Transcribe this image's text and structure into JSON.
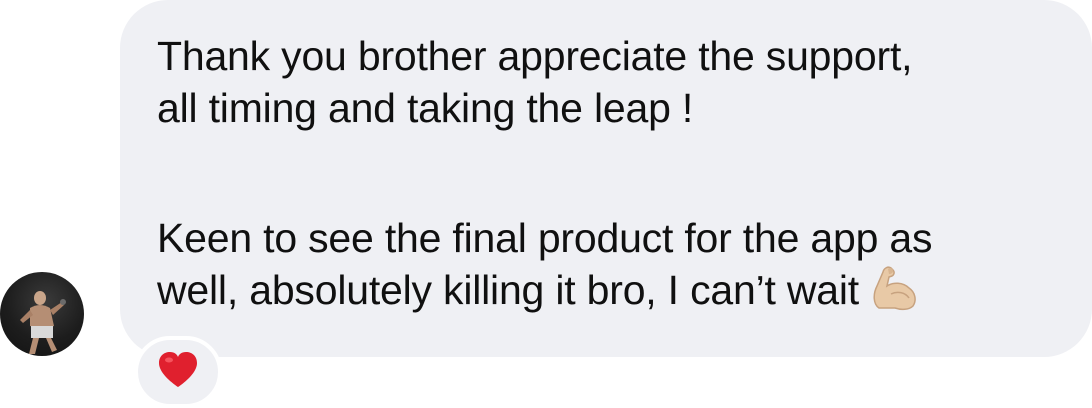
{
  "message": {
    "paragraph1_line1": "Thank you brother appreciate the support,",
    "paragraph1_line2": "all timing and taking the leap !",
    "paragraph2_line1": "Keen to see the final product for the app as",
    "paragraph2_line2": "well, absolutely killing it bro, I can’t wait",
    "trailing_emoji": "flexed-biceps-icon"
  },
  "reaction": {
    "icon": "heart-icon",
    "color": "#e0202e"
  },
  "colors": {
    "bubble_background": "#eff0f4",
    "text": "#101010"
  }
}
